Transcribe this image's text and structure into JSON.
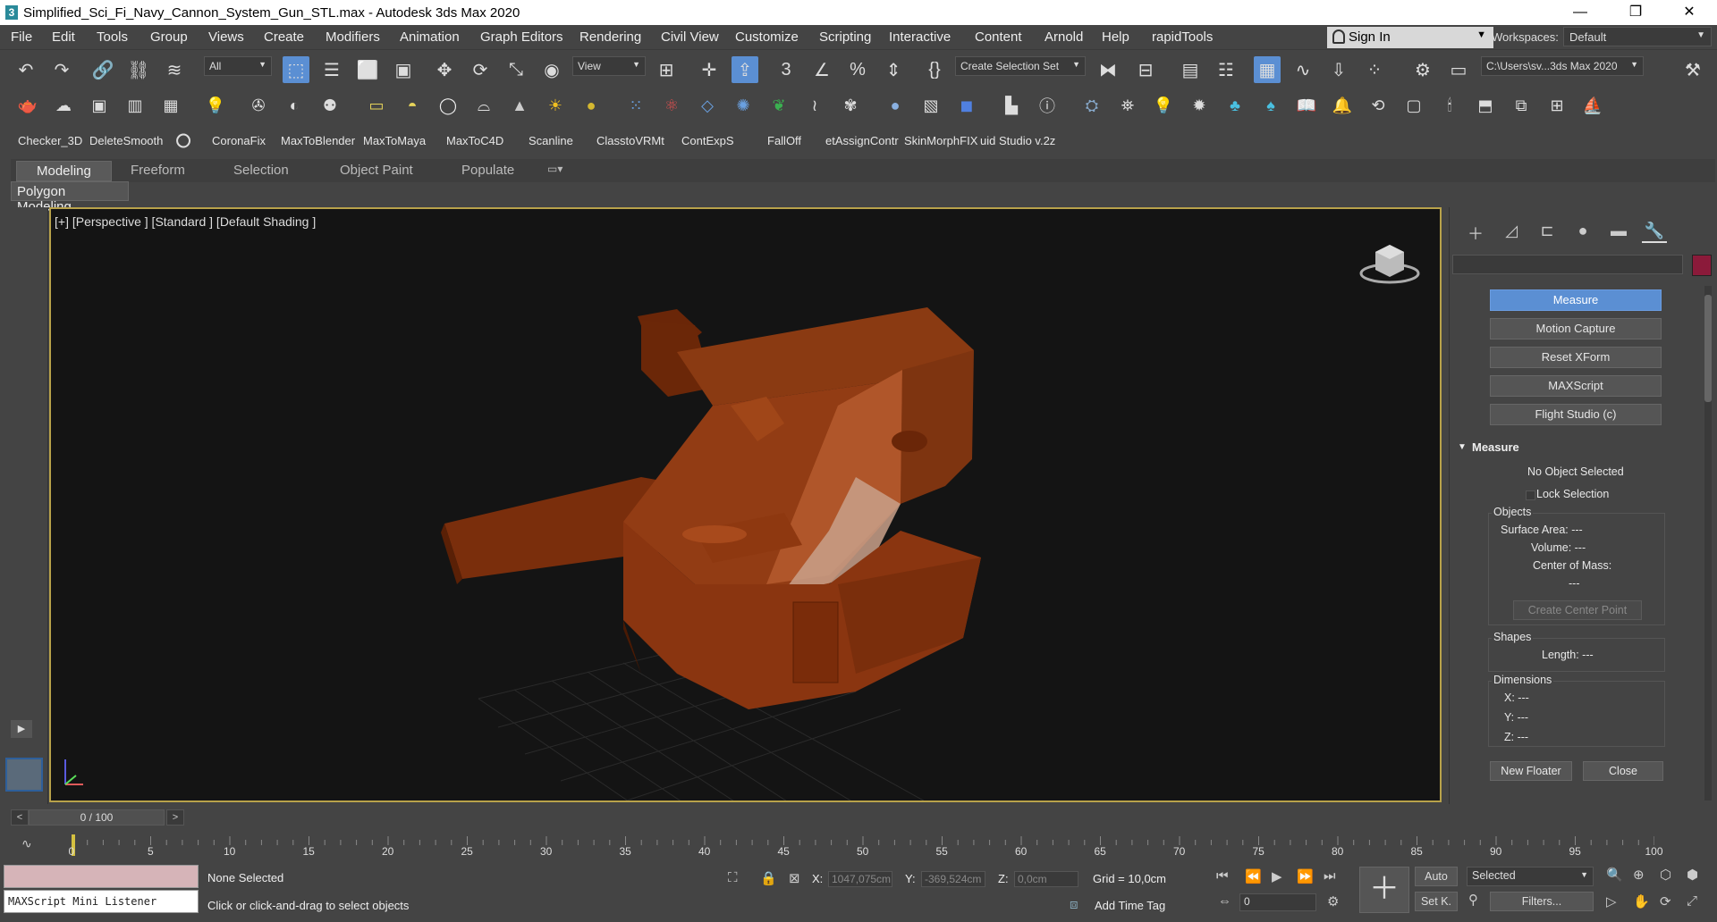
{
  "window": {
    "title": "Simplified_Sci_Fi_Navy_Cannon_System_Gun_STL.max - Autodesk 3ds Max 2020",
    "app_icon": "3",
    "minimize": "—",
    "maximize": "❐",
    "close": "✕"
  },
  "menu": [
    "File",
    "Edit",
    "Tools",
    "Group",
    "Views",
    "Create",
    "Modifiers",
    "Animation",
    "Graph Editors",
    "Rendering",
    "Civil View",
    "Customize",
    "Scripting",
    "Interactive",
    "Content",
    "Arnold",
    "Help",
    "rapidTools"
  ],
  "account": {
    "sign_in": "Sign In"
  },
  "workspace": {
    "label": "Workspaces:",
    "value": "Default"
  },
  "toolbar": {
    "filter_value": "All",
    "coord_system": "View",
    "selection_set": "Create Selection Set",
    "project_path": "C:\\Users\\sv...3ds Max 2020"
  },
  "scripts": [
    "Checker_3D",
    "DeleteSmooth",
    "CoronaFix",
    "MaxToBlender",
    "MaxToMaya",
    "MaxToC4D",
    "Scanline",
    "ClasstoVRMt",
    "ContExpS",
    "FallOff",
    "etAssignContr",
    "SkinMorphFIX",
    "uid Studio v.2z"
  ],
  "ribbon": {
    "tabs": [
      "Modeling",
      "Freeform",
      "Selection",
      "Object Paint",
      "Populate"
    ],
    "active_tab": "Modeling",
    "panel": "Polygon Modeling"
  },
  "viewport": {
    "label": "[+] [Perspective ] [Standard ] [Default Shading ]",
    "model_color": "#8a3a12"
  },
  "command_panel": {
    "utilities": [
      "Measure",
      "Motion Capture",
      "Reset XForm",
      "MAXScript",
      "Flight Studio (c)"
    ],
    "active_utility": "Measure",
    "rollout": "Measure",
    "no_selection": "No Object Selected",
    "lock_selection": "Lock Selection",
    "objects_group": "Objects",
    "surface_area": "Surface Area:  ---",
    "volume": "Volume:  ---",
    "center_of_mass": "Center of Mass:",
    "center_of_mass_value": "---",
    "create_center_point": "Create Center Point",
    "shapes_group": "Shapes",
    "length": "Length:  ---",
    "dimensions_group": "Dimensions",
    "x": "X:   ---",
    "y": "Y:   ---",
    "z": "Z:   ---",
    "new_floater": "New Floater",
    "close": "Close",
    "swatch_color": "#8b1a3a"
  },
  "timeline": {
    "frame_display": "0 / 100",
    "ticks": [
      "0",
      "5",
      "10",
      "15",
      "20",
      "25",
      "30",
      "35",
      "40",
      "45",
      "50",
      "55",
      "60",
      "65",
      "70",
      "75",
      "80",
      "85",
      "90",
      "95",
      "100"
    ],
    "prev": "<",
    "next": ">"
  },
  "status": {
    "listener": "MAXScript Mini Listener",
    "selection": "None Selected",
    "prompt": "Click or click-and-drag to select objects",
    "x_label": "X:",
    "x_value": "1047,075cm",
    "y_label": "Y:",
    "y_value": "-369,524cm",
    "z_label": "Z:",
    "z_value": "0,0cm",
    "grid": "Grid = 10,0cm",
    "add_time_tag": "Add Time Tag",
    "auto": "Auto",
    "set_key": "Set K.",
    "selected": "Selected",
    "filters": "Filters...",
    "frame": "0"
  }
}
